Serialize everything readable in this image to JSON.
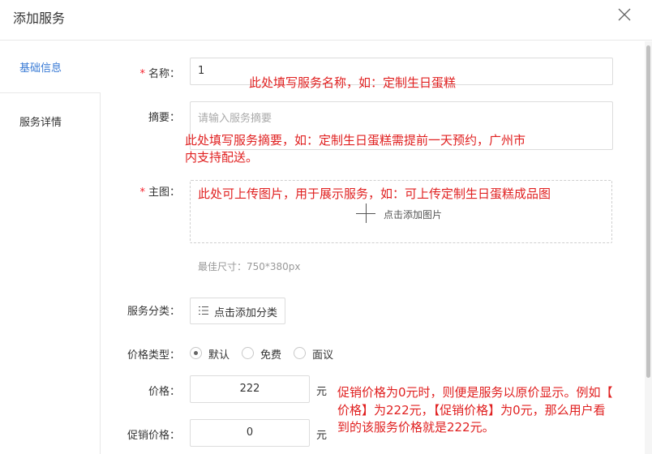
{
  "dialog": {
    "title": "添加服务"
  },
  "tabs": {
    "basic": "基础信息",
    "detail": "服务详情"
  },
  "form": {
    "name": {
      "required_mark": "*",
      "label": "名称：",
      "value": "1"
    },
    "summary": {
      "label": "摘要：",
      "placeholder": "请输入服务摘要"
    },
    "main_image": {
      "required_mark": "*",
      "label": "主图：",
      "upload_text": "点击添加图片",
      "size_hint": "最佳尺寸：750*380px"
    },
    "category": {
      "label": "服务分类：",
      "button_text": "点击添加分类"
    },
    "price_type": {
      "label": "价格类型：",
      "options": [
        "默认",
        "免费",
        "面议"
      ],
      "selected": "默认"
    },
    "price": {
      "label": "价格：",
      "value": "222",
      "unit": "元"
    },
    "promo_price": {
      "label": "促销价格：",
      "value": "0",
      "unit": "元"
    }
  },
  "annotations": {
    "name_note": "此处填写服务名称，如：定制生日蛋糕",
    "summary_note_line1": "此处填写服务摘要，如：定制生日蛋糕需提前一天预约，广州市",
    "summary_note_line2": "内支持配送。",
    "image_note": "此处可上传图片，用于展示服务，如：可上传定制生日蛋糕成品图",
    "price_note_line1": "促销价格为0元时，则便是服务以原价显示。例如【",
    "price_note_line2": "价格】为222元，【促销价格】为0元，那么用户看",
    "price_note_line3": "到的该服务价格就是222元。"
  }
}
